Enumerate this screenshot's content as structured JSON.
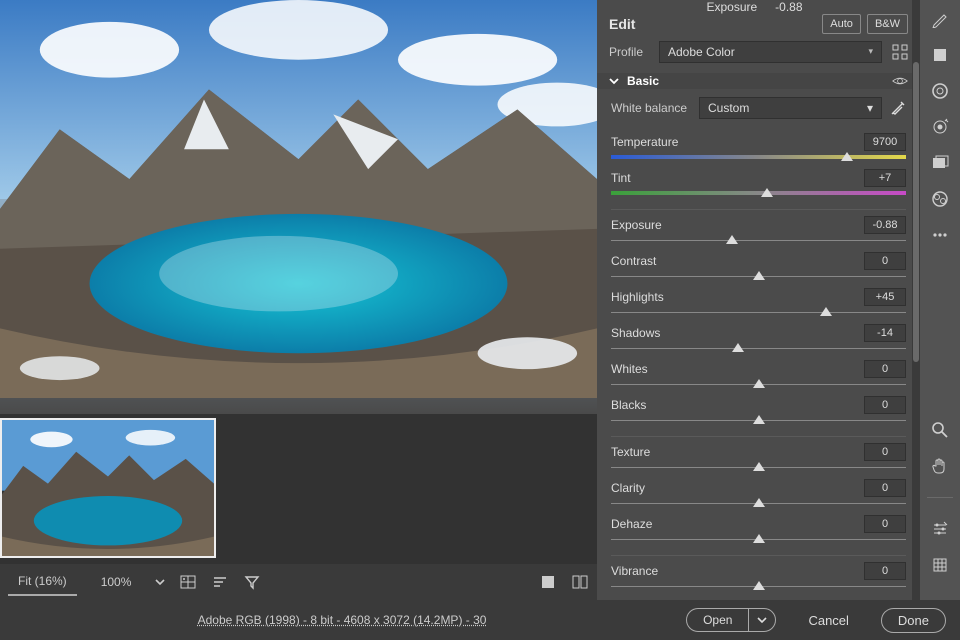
{
  "histogram": {
    "label": "Exposure",
    "value": "-0.88"
  },
  "edit": {
    "title": "Edit",
    "auto": "Auto",
    "bw": "B&W"
  },
  "profile": {
    "label": "Profile",
    "value": "Adobe Color"
  },
  "basic": {
    "title": "Basic"
  },
  "wb": {
    "label": "White balance",
    "value": "Custom"
  },
  "sliders": {
    "temperature": {
      "name": "Temperature",
      "display": "9700",
      "pos": 0.8,
      "track": "temp"
    },
    "tint": {
      "name": "Tint",
      "display": "+7",
      "pos": 0.53,
      "track": "tint"
    },
    "exposure": {
      "name": "Exposure",
      "display": "-0.88",
      "pos": 0.41
    },
    "contrast": {
      "name": "Contrast",
      "display": "0",
      "pos": 0.5
    },
    "highlights": {
      "name": "Highlights",
      "display": "+45",
      "pos": 0.73
    },
    "shadows": {
      "name": "Shadows",
      "display": "-14",
      "pos": 0.43
    },
    "whites": {
      "name": "Whites",
      "display": "0",
      "pos": 0.5
    },
    "blacks": {
      "name": "Blacks",
      "display": "0",
      "pos": 0.5
    },
    "texture": {
      "name": "Texture",
      "display": "0",
      "pos": 0.5
    },
    "clarity": {
      "name": "Clarity",
      "display": "0",
      "pos": 0.5
    },
    "dehaze": {
      "name": "Dehaze",
      "display": "0",
      "pos": 0.5
    },
    "vibrance": {
      "name": "Vibrance",
      "display": "0",
      "pos": 0.5
    }
  },
  "zoom": {
    "fit": "Fit (16%)",
    "hundred": "100%"
  },
  "footer": {
    "meta": "Adobe RGB (1998) - 8 bit - 4608 x 3072 (14.2MP) - 30",
    "open": "Open",
    "cancel": "Cancel",
    "done": "Done"
  }
}
